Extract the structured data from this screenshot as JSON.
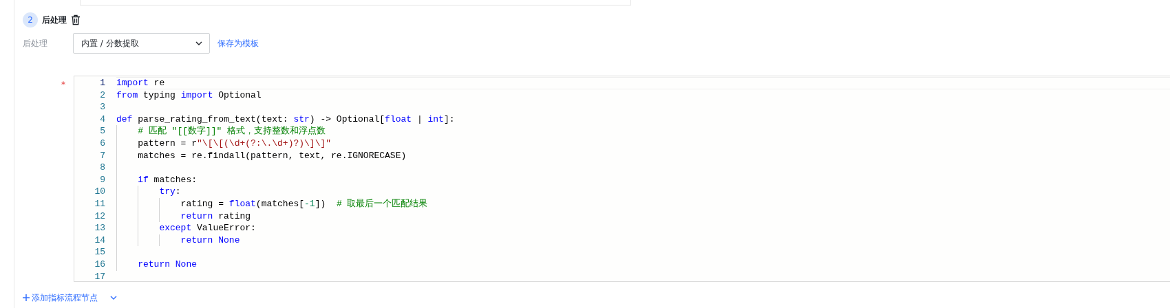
{
  "step": {
    "number": "2",
    "title": "后处理"
  },
  "form": {
    "label": "后处理",
    "select_value": "内置 / 分数提取",
    "link": "保存为模板",
    "required_mark": "*"
  },
  "editor": {
    "lines": [
      {
        "number": "1",
        "active": true,
        "tokens": [
          {
            "kind": "keyword",
            "text": "import"
          },
          {
            "kind": "plain",
            "text": " re"
          }
        ]
      },
      {
        "number": "2",
        "active": false,
        "tokens": [
          {
            "kind": "keyword",
            "text": "from"
          },
          {
            "kind": "plain",
            "text": " typing "
          },
          {
            "kind": "keyword",
            "text": "import"
          },
          {
            "kind": "plain",
            "text": " Optional"
          }
        ]
      },
      {
        "number": "3",
        "active": false
      },
      {
        "number": "4",
        "active": false,
        "tokens": [
          {
            "kind": "keyword",
            "text": "def"
          },
          {
            "kind": "plain",
            "text": " parse_rating_from_text(text: "
          },
          {
            "kind": "keyword",
            "text": "str"
          },
          {
            "kind": "plain",
            "text": ") -> Optional["
          },
          {
            "kind": "keyword",
            "text": "float"
          },
          {
            "kind": "plain",
            "text": " | "
          },
          {
            "kind": "keyword",
            "text": "int"
          },
          {
            "kind": "plain",
            "text": "]:"
          }
        ]
      },
      {
        "number": "5",
        "active": false,
        "tokens": [
          {
            "kind": "comment",
            "text": "    # 匹配 \"[[数字]]\" 格式，支持整数和浮点数"
          }
        ]
      },
      {
        "number": "6",
        "active": false,
        "tokens": [
          {
            "kind": "plain",
            "text": "    pattern = r"
          },
          {
            "kind": "string",
            "text": "\"\\[\\[(\\d+(?:\\.\\d+)?)\\]\\]\""
          }
        ]
      },
      {
        "number": "7",
        "active": false,
        "tokens": [
          {
            "kind": "plain",
            "text": "    matches = re.findall(pattern, text, re.IGNORECASE)"
          }
        ]
      },
      {
        "number": "8",
        "active": false
      },
      {
        "number": "9",
        "active": false,
        "tokens": [
          {
            "kind": "keyword",
            "text": "    if"
          },
          {
            "kind": "plain",
            "text": " matches:"
          }
        ]
      },
      {
        "number": "10",
        "active": false,
        "tokens": [
          {
            "kind": "keyword",
            "text": "        try"
          },
          {
            "kind": "plain",
            "text": ":"
          }
        ]
      },
      {
        "number": "11",
        "active": false,
        "tokens": [
          {
            "kind": "plain",
            "text": "            rating = "
          },
          {
            "kind": "keyword",
            "text": "float"
          },
          {
            "kind": "plain",
            "text": "(matches["
          },
          {
            "kind": "number",
            "text": "-1"
          },
          {
            "kind": "plain",
            "text": "])  "
          },
          {
            "kind": "comment",
            "text": "# 取最后一个匹配结果"
          }
        ]
      },
      {
        "number": "12",
        "active": false,
        "tokens": [
          {
            "kind": "keyword",
            "text": "            return"
          },
          {
            "kind": "plain",
            "text": " rating"
          }
        ]
      },
      {
        "number": "13",
        "active": false,
        "tokens": [
          {
            "kind": "keyword",
            "text": "        except"
          },
          {
            "kind": "plain",
            "text": " ValueError:"
          }
        ]
      },
      {
        "number": "14",
        "active": false,
        "tokens": [
          {
            "kind": "keyword",
            "text": "            return None"
          }
        ]
      },
      {
        "number": "15",
        "active": false
      },
      {
        "number": "16",
        "active": false,
        "tokens": [
          {
            "kind": "keyword",
            "text": "    return None"
          }
        ]
      },
      {
        "number": "17",
        "active": false
      }
    ]
  },
  "footer": {
    "add_label": "添加指标流程节点"
  }
}
